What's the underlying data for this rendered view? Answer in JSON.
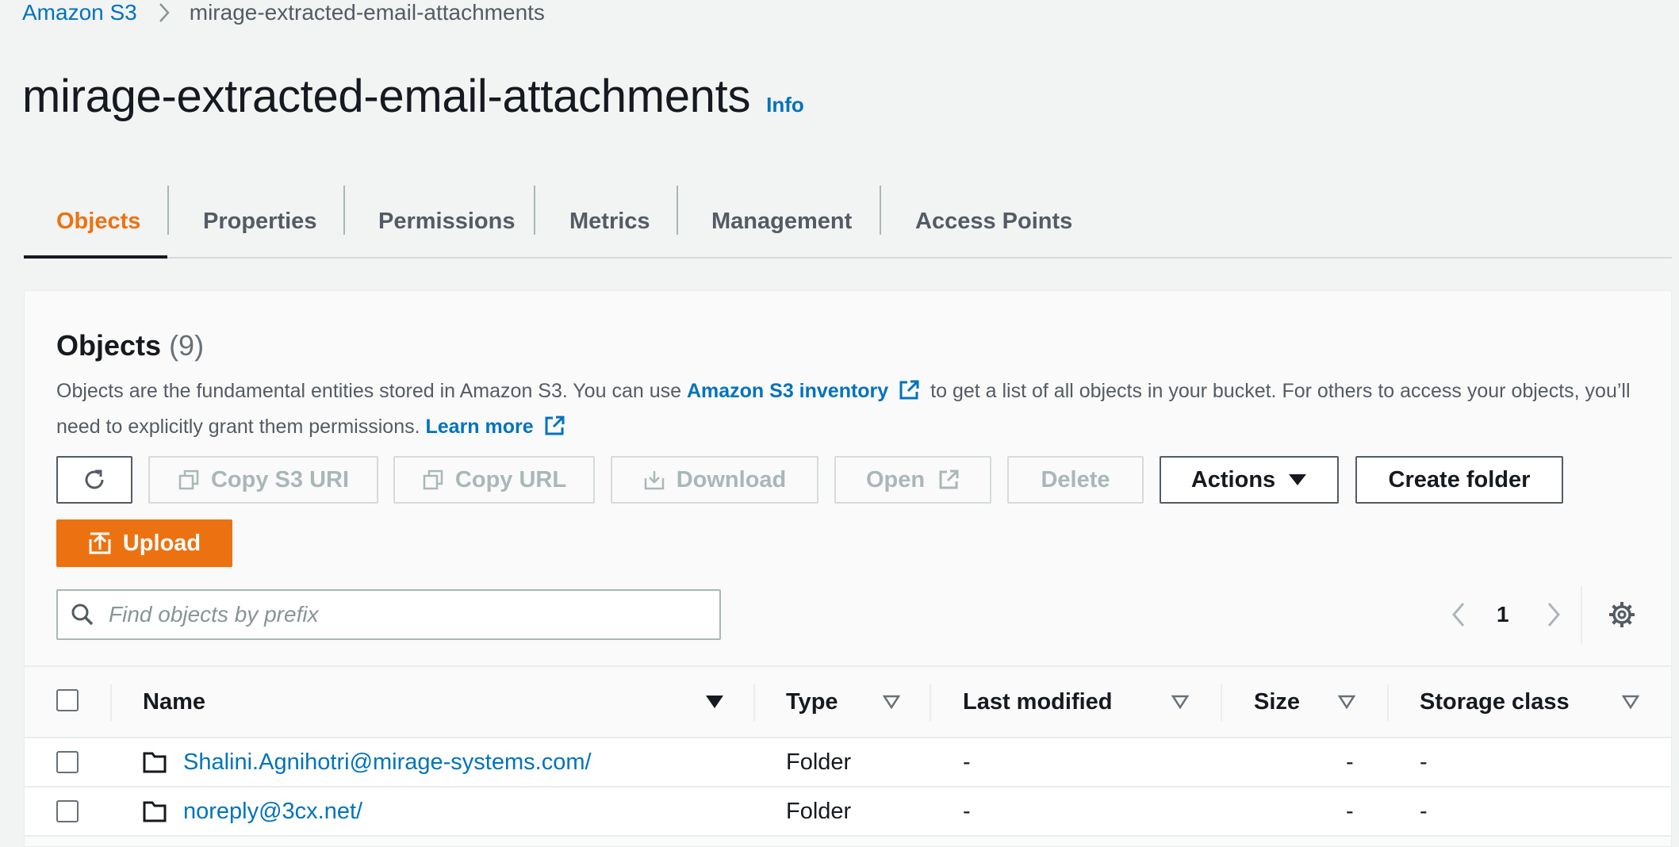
{
  "breadcrumb": {
    "root": "Amazon S3",
    "current": "mirage-extracted-email-attachments"
  },
  "page": {
    "title": "mirage-extracted-email-attachments",
    "info": "Info"
  },
  "tabs": [
    {
      "label": "Objects",
      "active": true
    },
    {
      "label": "Properties"
    },
    {
      "label": "Permissions"
    },
    {
      "label": "Metrics"
    },
    {
      "label": "Management"
    },
    {
      "label": "Access Points"
    }
  ],
  "objects": {
    "title": "Objects",
    "count": "(9)",
    "desc_1": "Objects are the fundamental entities stored in Amazon S3. You can use",
    "inventory_link": "Amazon S3 inventory",
    "desc_2": "to get a list of all objects in your bucket. For others to access your objects, you’ll need to explicitly grant them permissions.",
    "learn_more": "Learn more"
  },
  "toolbar": {
    "copy_s3_uri": "Copy S3 URI",
    "copy_url": "Copy URL",
    "download": "Download",
    "open": "Open",
    "delete": "Delete",
    "actions": "Actions",
    "create_folder": "Create folder",
    "upload": "Upload"
  },
  "search": {
    "placeholder": "Find objects by prefix",
    "value": ""
  },
  "pagination": {
    "current_page": "1"
  },
  "table": {
    "columns": [
      "Name",
      "Type",
      "Last modified",
      "Size",
      "Storage class"
    ],
    "rows": [
      {
        "name": "Shalini.Agnihotri@mirage-systems.com/",
        "type": "Folder",
        "last_modified": "-",
        "size": "-",
        "storage_class": "-"
      },
      {
        "name": "noreply@3cx.net/",
        "type": "Folder",
        "last_modified": "-",
        "size": "-",
        "storage_class": "-"
      }
    ]
  },
  "colors": {
    "link": "#0073bb",
    "accent": "#ec7211",
    "text": "#16191f",
    "muted": "#545b64",
    "disabled": "#aab7b8"
  },
  "icons": [
    "chevron-right-icon",
    "external-link-icon",
    "refresh-icon",
    "copy-icon",
    "download-icon",
    "caret-down-icon",
    "upload-icon",
    "search-icon",
    "chevron-left-icon",
    "settings-gear-icon",
    "sort-down-icon",
    "sort-outline-icon",
    "folder-icon"
  ]
}
